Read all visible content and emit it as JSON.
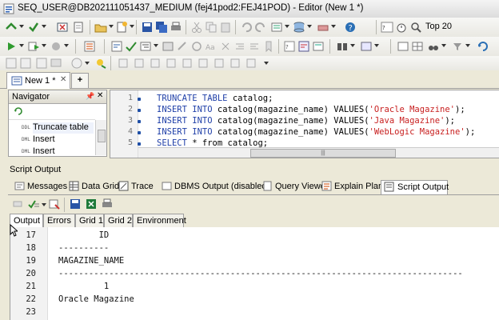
{
  "window": {
    "title": "SEQ_USER@DB202111051437_MEDIUM (fej41pod2:FEJ41POD) - Editor (New 1 *)"
  },
  "toolbar1": {
    "top_label": "Top 20"
  },
  "tabs": {
    "doc_tab": "New 1 *",
    "add_tab": "+"
  },
  "navigator": {
    "title": "Navigator",
    "items": [
      {
        "tag": "DDL",
        "label": "Truncate table"
      },
      {
        "tag": "DML",
        "label": "Insert"
      },
      {
        "tag": "DML",
        "label": "Insert"
      }
    ]
  },
  "editor": {
    "line_numbers": [
      "1",
      "2",
      "3",
      "4",
      "5"
    ],
    "lines": [
      {
        "kw": "TRUNCATE TABLE",
        "rest": " catalog;",
        "pre": "",
        "str": "",
        "post": ""
      },
      {
        "kw": "INSERT INTO",
        "rest": " catalog(magazine_name) ",
        "pre": "VALUES(",
        "str": "'Oracle Magazine'",
        "post": ");"
      },
      {
        "kw": "INSERT INTO",
        "rest": " catalog(magazine_name) ",
        "pre": "VALUES(",
        "str": "'Java Magazine'",
        "post": ");"
      },
      {
        "kw": "INSERT INTO",
        "rest": " catalog(magazine_name) ",
        "pre": "VALUES(",
        "str": "'WebLogic Magazine'",
        "post": ");"
      },
      {
        "kw": "SELECT",
        "rest": " * from catalog;",
        "pre": "",
        "str": "",
        "post": ""
      }
    ],
    "scroll_grip": "|||"
  },
  "script_output_label": "Script Output",
  "result_tabs": [
    "Messages",
    "Data Grid",
    "Trace",
    "DBMS Output (disabled)",
    "Query Viewer",
    "Explain Plan",
    "Script Output"
  ],
  "sub_tabs": [
    "Output",
    "Errors",
    "Grid 1",
    "Grid 2",
    "Environment"
  ],
  "output": {
    "line_numbers": [
      "17",
      "18",
      "19",
      "20",
      "21",
      "22",
      "23"
    ],
    "lines": [
      "        ID",
      "----------",
      "MAGAZINE_NAME",
      "--------------------------------------------------------------------------------",
      "         1",
      "Oracle Magazine",
      ""
    ]
  },
  "colors": {
    "keyword": "#1f3fa8",
    "string": "#c82020",
    "chrome": "#ece9d8"
  }
}
